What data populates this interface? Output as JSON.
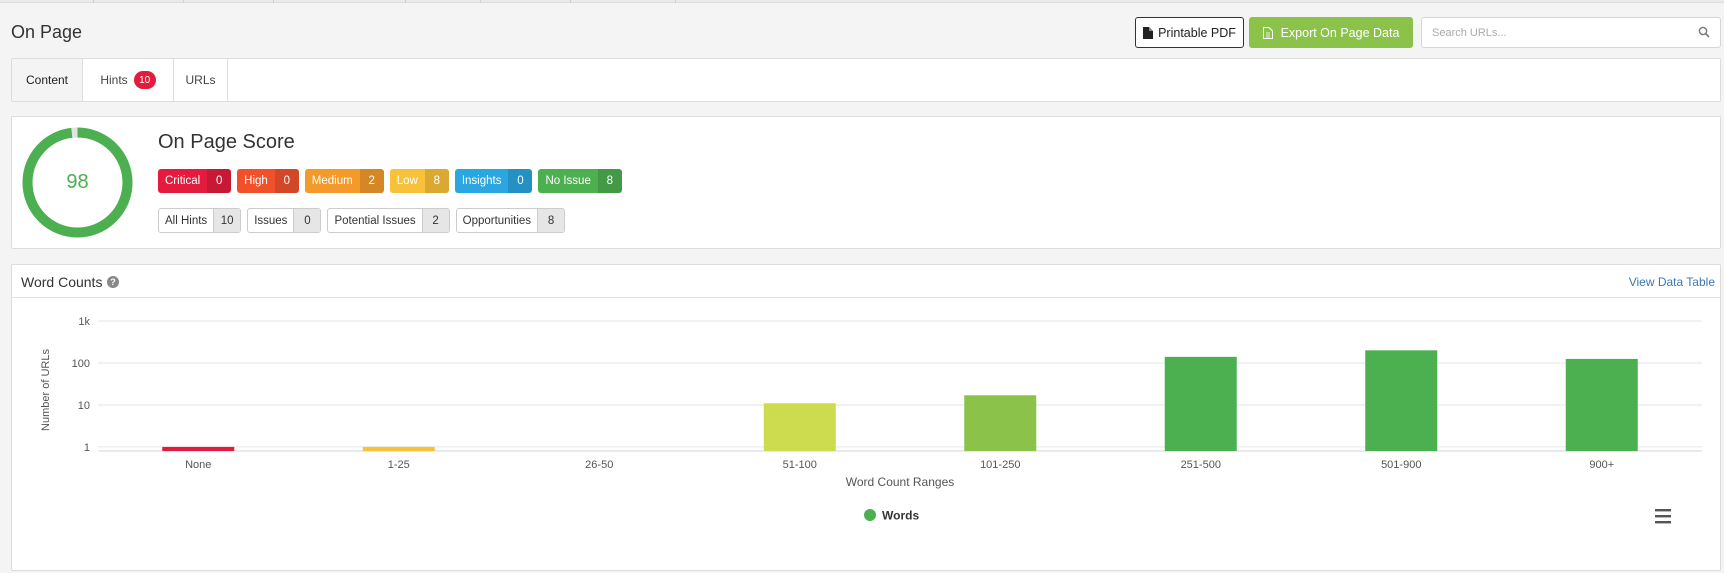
{
  "page": {
    "title": "On Page"
  },
  "toolbar": {
    "pdf_label": "Printable PDF",
    "export_label": "Export On Page Data",
    "search_placeholder": "Search URLs..."
  },
  "tabs": [
    {
      "label": "Content"
    },
    {
      "label": "Hints",
      "badge": "10"
    },
    {
      "label": "URLs"
    }
  ],
  "score": {
    "title": "On Page Score",
    "value": "98",
    "percent": 98,
    "severity": [
      {
        "label": "Critical",
        "count": "0",
        "color": "#e31c3d"
      },
      {
        "label": "High",
        "count": "0",
        "color": "#f0512b"
      },
      {
        "label": "Medium",
        "count": "2",
        "color": "#f39a2b"
      },
      {
        "label": "Low",
        "count": "8",
        "color": "#f8c13a"
      },
      {
        "label": "Insights",
        "count": "0",
        "color": "#2aa6e0"
      },
      {
        "label": "No Issue",
        "count": "8",
        "color": "#4caf50"
      }
    ],
    "hints": [
      {
        "label": "All Hints",
        "count": "10"
      },
      {
        "label": "Issues",
        "count": "0"
      },
      {
        "label": "Potential Issues",
        "count": "2"
      },
      {
        "label": "Opportunities",
        "count": "8"
      }
    ]
  },
  "word_counts": {
    "title": "Word Counts",
    "view_table_label": "View Data Table"
  },
  "chart_data": {
    "type": "bar",
    "scale": "log",
    "categories": [
      "None",
      "1-25",
      "26-50",
      "51-100",
      "101-250",
      "251-500",
      "501-900",
      "900+"
    ],
    "series": [
      {
        "name": "Words",
        "values": [
          1,
          1,
          null,
          11,
          17,
          140,
          200,
          125
        ],
        "colors": [
          "#e31c3d",
          "#f8c13a",
          null,
          "#cddc4f",
          "#8bc34a",
          "#4caf50",
          "#4caf50",
          "#4caf50"
        ]
      }
    ],
    "xlabel": "Word Count Ranges",
    "ylabel": "Number of URLs",
    "yticks": [
      {
        "value": 1,
        "label": "1"
      },
      {
        "value": 10,
        "label": "10"
      },
      {
        "value": 100,
        "label": "100"
      },
      {
        "value": 1000,
        "label": "1k"
      }
    ],
    "ylim": [
      0.8,
      1000
    ],
    "grid": true,
    "legend": {
      "position": "bottom-center",
      "color": "#4caf50"
    }
  }
}
